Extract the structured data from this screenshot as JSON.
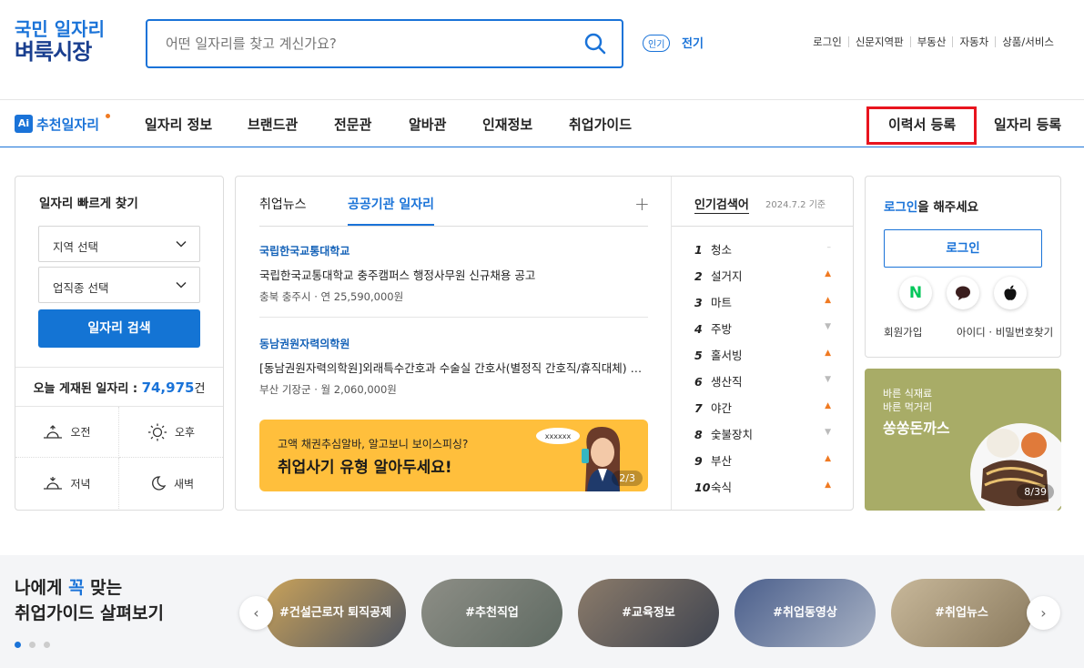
{
  "logo": {
    "line1": "국민 일자리",
    "line2": "벼룩시장"
  },
  "search": {
    "placeholder": "어떤 일자리를 찾고 계신가요?"
  },
  "trend": {
    "badge": "인기",
    "word": "전기"
  },
  "toplinks": [
    "로그인",
    "신문지역판",
    "부동산",
    "자동차",
    "상품/서비스"
  ],
  "nav": {
    "ai": "Ai",
    "recommend": "추천일자리",
    "items": [
      "일자리 정보",
      "브랜드관",
      "전문관",
      "알바관",
      "인재정보",
      "취업가이드"
    ],
    "resume": "이력서 등록",
    "job_post": "일자리 등록"
  },
  "quick": {
    "title": "일자리 빠르게 찾기",
    "region": "지역 선택",
    "category": "업직종 선택",
    "search_btn": "일자리 검색",
    "today_label": "오늘 게재된 일자리 :",
    "today_count": "74,975",
    "today_unit": "건",
    "times": [
      "오전",
      "오후",
      "저녁",
      "새벽"
    ]
  },
  "news": {
    "tabs": [
      "취업뉴스",
      "공공기관 일자리"
    ],
    "plus": "+",
    "jobs": [
      {
        "org": "국립한국교통대학교",
        "title": "국립한국교통대학교 충주캠퍼스 행정사무원 신규채용 공고",
        "location": "충북 충주시",
        "pay": "· 연 25,590,000원"
      },
      {
        "org": "동남권원자력의학원",
        "title": "[동남권원자력의학원]외래특수간호과 수술실 간호사(별정직 간호직/휴직대체) 계약직 채용",
        "location": "부산 기장군",
        "pay": "· 월 2,060,000원"
      }
    ],
    "banner": {
      "line1": "고액 채권추심알바, 알고보니 보이스피싱?",
      "line2": "취업사기 유형 알아두세요!",
      "bubble": "xxxxxx",
      "page": "2/3"
    }
  },
  "popular": {
    "title": "인기검색어",
    "date": "2024.7.2 기준",
    "items": [
      {
        "rank": "1",
        "word": "청소",
        "trend": "–"
      },
      {
        "rank": "2",
        "word": "설거지",
        "trend": "▲"
      },
      {
        "rank": "3",
        "word": "마트",
        "trend": "▲"
      },
      {
        "rank": "4",
        "word": "주방",
        "trend": "▼"
      },
      {
        "rank": "5",
        "word": "홀서빙",
        "trend": "▲"
      },
      {
        "rank": "6",
        "word": "생산직",
        "trend": "▼"
      },
      {
        "rank": "7",
        "word": "야간",
        "trend": "▲"
      },
      {
        "rank": "8",
        "word": "숯불장치",
        "trend": "▼"
      },
      {
        "rank": "9",
        "word": "부산",
        "trend": "▲"
      },
      {
        "rank": "10",
        "word": "숙식",
        "trend": "▲"
      }
    ]
  },
  "login": {
    "msg_hl": "로그인",
    "msg_rest": "을 해주세요",
    "btn": "로그인",
    "naver": "N",
    "join": "회원가입",
    "find": "아이디 · 비밀번호찾기"
  },
  "ad": {
    "line1": "바른 식재료",
    "line2": "바른 먹거리",
    "brand": "쏭쏭돈까스",
    "page": "8/39"
  },
  "guide": {
    "h1a": "나에게 ",
    "h1b": "꼭",
    "h1c": " 맞는",
    "h2": "취업가이드 살펴보기",
    "pills": [
      "#건설근로자 퇴직공제",
      "#추천직업",
      "#교육정보",
      "#취업동영상",
      "#취업뉴스"
    ]
  },
  "colors": {
    "primary": "#1a73d8",
    "up": "#f07a22",
    "down": "#bbbbbb"
  }
}
